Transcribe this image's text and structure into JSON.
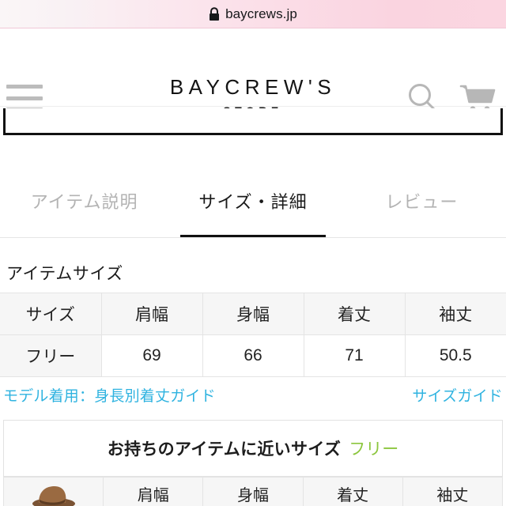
{
  "browser": {
    "lock_icon": "lock-icon",
    "url": "baycrews.jp"
  },
  "header": {
    "menu_icon": "hamburger-menu-icon",
    "brand_main": "BAYCREW'S",
    "brand_sub": "STORE",
    "search_icon": "search-icon",
    "cart_icon": "shopping-cart-icon"
  },
  "tabs": [
    {
      "label": "アイテム説明",
      "active": false
    },
    {
      "label": "サイズ・詳細",
      "active": true
    },
    {
      "label": "レビュー",
      "active": false
    }
  ],
  "item_size": {
    "title": "アイテムサイズ",
    "columns": [
      "サイズ",
      "肩幅",
      "身幅",
      "着丈",
      "袖丈"
    ],
    "rows": [
      [
        "フリー",
        "69",
        "66",
        "71",
        "50.5"
      ]
    ]
  },
  "guides": {
    "model_guide": "モデル着用：身長別着丈ガイド",
    "size_guide": "サイズガイド",
    "link_color": "#2fb3e0"
  },
  "compare": {
    "label": "お持ちのアイテムに近いサイズ",
    "size": "フリー",
    "size_color": "#8cc63e",
    "columns": [
      "",
      "肩幅",
      "身幅",
      "着丈",
      "袖丈"
    ],
    "thumbnail_icon": "product-thumbnail-hat"
  }
}
